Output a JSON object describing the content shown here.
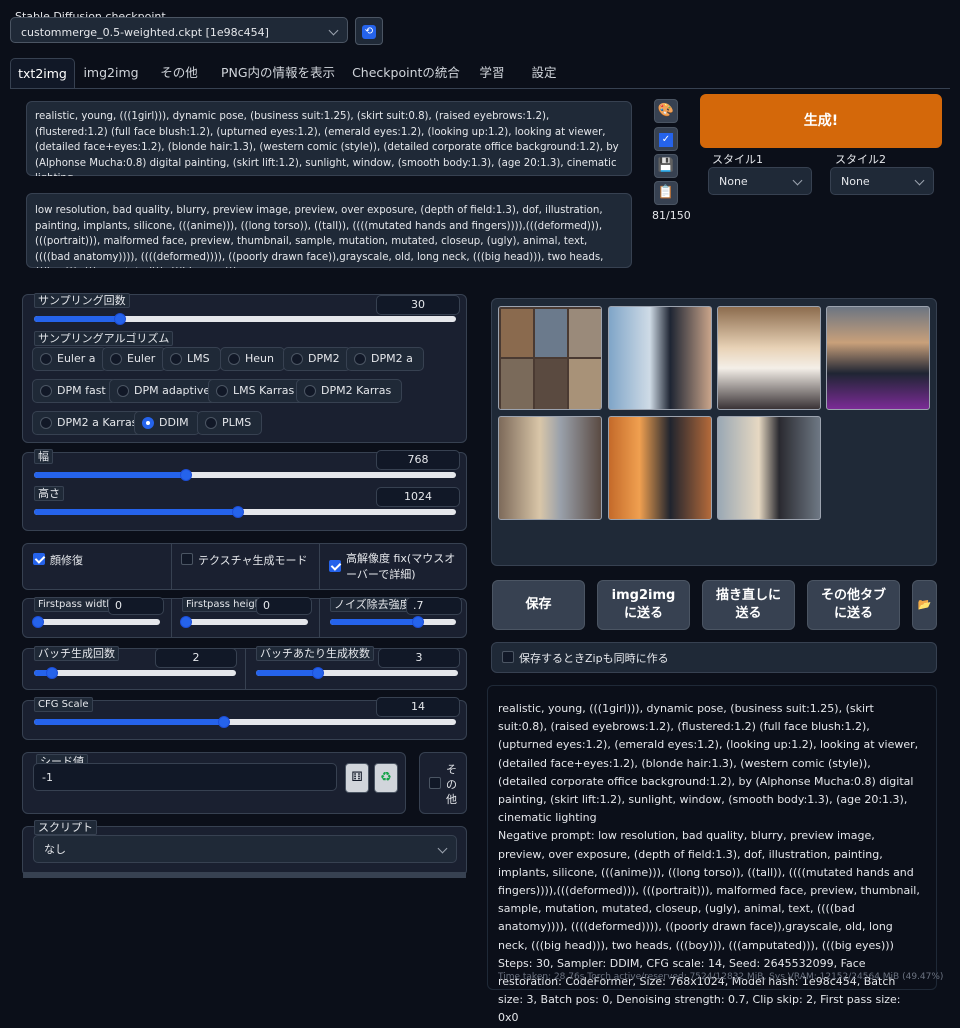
{
  "checkpoint": {
    "label": "Stable Diffusion checkpoint",
    "value": "custommerge_0.5-weighted.ckpt [1e98c454]"
  },
  "tabs": [
    "txt2img",
    "img2img",
    "その他",
    "PNG内の情報を表示",
    "Checkpointの統合",
    "学習",
    "設定"
  ],
  "prompt": "realistic, young, (((1girl))), dynamic pose, (business suit:1.25), (skirt suit:0.8), (raised eyebrows:1.2), (flustered:1.2) (full face blush:1.2), (upturned eyes:1.2), (emerald eyes:1.2), (looking up:1.2), looking at viewer, (detailed face+eyes:1.2), (blonde hair:1.3), (western comic (style)), (detailed corporate office background:1.2), by (Alphonse Mucha:0.8) digital painting, (skirt lift:1.2), sunlight, window, (smooth body:1.3), (age 20:1.3), cinematic lighting",
  "negative_prompt": "low resolution, bad quality, blurry, preview image, preview, over exposure, (depth of field:1.3), dof, illustration, painting, implants, silicone, (((anime))), ((long torso)), ((tall)), ((((mutated hands and fingers)))),(((deformed))), (((portrait))), malformed face, preview, thumbnail, sample, mutation, mutated, closeup, (ugly), animal, text, ((((bad anatomy)))), ((((deformed)))), ((poorly drawn face)),grayscale, old, long neck, (((big head))), two heads, (((boy))), (((amputated))), (((big eyes)))",
  "token_count": "81/150",
  "generate_label": "生成!",
  "style1": {
    "label": "スタイル1",
    "value": "None"
  },
  "style2": {
    "label": "スタイル2",
    "value": "None"
  },
  "sampling_steps": {
    "label": "サンプリング回数",
    "value": "30",
    "fraction": 0.2
  },
  "sampler": {
    "label": "サンプリングアルゴリズム",
    "options": [
      "Euler a",
      "Euler",
      "LMS",
      "Heun",
      "DPM2",
      "DPM2 a",
      "DPM fast",
      "DPM adaptive",
      "LMS Karras",
      "DPM2 Karras",
      "DPM2 a Karras",
      "DDIM",
      "PLMS"
    ],
    "selected": "DDIM"
  },
  "width": {
    "label": "幅",
    "value": "768",
    "fraction": 0.36
  },
  "height": {
    "label": "高さ",
    "value": "1024",
    "fraction": 0.48
  },
  "restore_faces": {
    "label": "顔修復",
    "checked": true
  },
  "tiling": {
    "label": "テクスチャ生成モード",
    "checked": false
  },
  "hires_fix": {
    "label": "高解像度 fix(マウスオーバーで詳細)",
    "checked": true
  },
  "firstpass_width": {
    "label": "Firstpass width",
    "value": "0",
    "fraction": 0.0
  },
  "firstpass_height": {
    "label": "Firstpass height",
    "value": "0",
    "fraction": 0.0
  },
  "denoising": {
    "label": "ノイズ除去強度",
    "value": ".7",
    "fraction": 0.7
  },
  "batch_count": {
    "label": "バッチ生成回数",
    "value": "2",
    "fraction": 0.04
  },
  "batch_size": {
    "label": "バッチあたり生成枚数",
    "value": "3",
    "fraction": 0.3
  },
  "cfg_scale": {
    "label": "CFG Scale",
    "value": "14",
    "fraction": 0.45
  },
  "seed": {
    "label": "シード値",
    "value": "-1"
  },
  "extra": {
    "label": "その他"
  },
  "script": {
    "label": "スクリプト",
    "value": "なし"
  },
  "actions": {
    "save": "保存",
    "to_img2img": "img2imgに送る",
    "to_inpaint": "描き直しに送る",
    "to_extras": "その他タブに送る"
  },
  "zip_label": "保存するときZipも同時に作る",
  "info_text": "realistic, young, (((1girl))), dynamic pose, (business suit:1.25), (skirt suit:0.8), (raised eyebrows:1.2), (flustered:1.2) (full face blush:1.2), (upturned eyes:1.2), (emerald eyes:1.2), (looking up:1.2), looking at viewer, (detailed face+eyes:1.2), (blonde hair:1.3), (western comic (style)), (detailed corporate office background:1.2), by (Alphonse Mucha:0.8) digital painting, (skirt lift:1.2), sunlight, window, (smooth body:1.3), (age 20:1.3), cinematic lighting",
  "info_negative": "Negative prompt: low resolution, bad quality, blurry, preview image, preview, over exposure, (depth of field:1.3), dof, illustration, painting, implants, silicone, (((anime))), ((long torso)), ((tall)), ((((mutated hands and fingers)))),(((deformed))), (((portrait))), malformed face, preview, thumbnail, sample, mutation, mutated, closeup, (ugly), animal, text, ((((bad anatomy)))), ((((deformed)))), ((poorly drawn face)),grayscale, old, long neck, (((big head))), two heads, (((boy))), (((amputated))), (((big eyes)))",
  "info_params": "Steps: 30, Sampler: DDIM, CFG scale: 14, Seed: 2645532099, Face restoration: CodeFormer, Size: 768x1024, Model hash: 1e98c454, Batch size: 3, Batch pos: 0, Denoising strength: 0.7, Clip skip: 2, First pass size: 0x0",
  "time_taken": "Time taken: 28.76s  Torch active/reserved: 7524/12832 MiB, Sys VRAM: 12152/24564 MiB (49.47%)",
  "colors": {
    "accent": "#2563eb",
    "generate": "#d4680a",
    "bg": "#0b0f19"
  }
}
